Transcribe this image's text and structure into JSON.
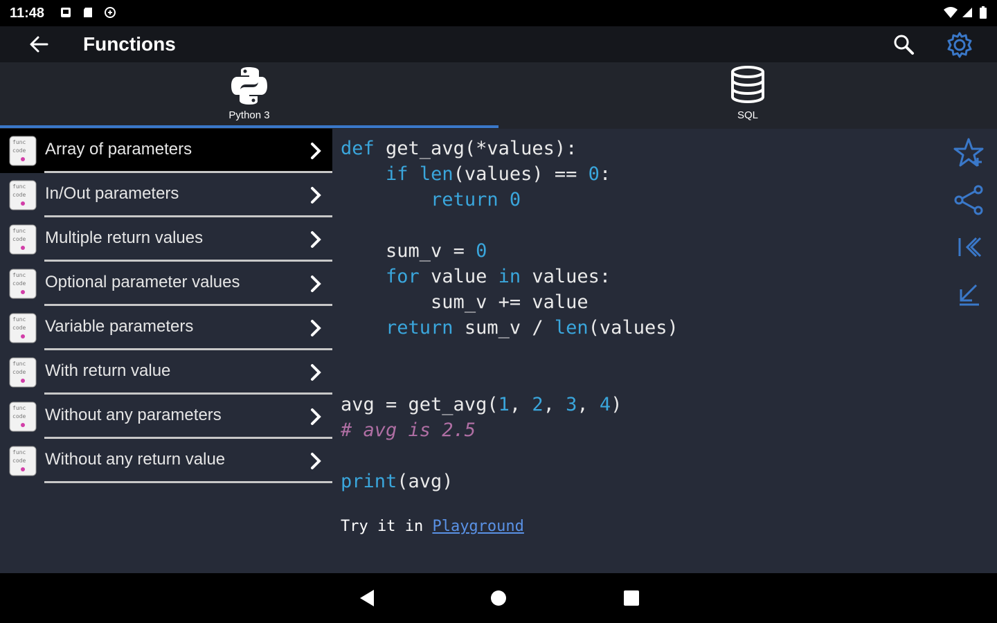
{
  "status": {
    "time": "11:48"
  },
  "appbar": {
    "title": "Functions"
  },
  "tabs": [
    {
      "label": "Python 3",
      "icon": "python-icon"
    },
    {
      "label": "SQL",
      "icon": "database-icon"
    }
  ],
  "list": [
    {
      "label": "Array of parameters"
    },
    {
      "label": "In/Out parameters"
    },
    {
      "label": "Multiple return values"
    },
    {
      "label": "Optional parameter values"
    },
    {
      "label": "Variable parameters"
    },
    {
      "label": "With return value"
    },
    {
      "label": "Without any parameters"
    },
    {
      "label": "Without any return value"
    }
  ],
  "code": {
    "l1": {
      "kw": "def",
      "rest": " get_avg(*values):"
    },
    "l2": {
      "indent": "    ",
      "kw": "if",
      "sp": " ",
      "fn": "len",
      "rest": "(values) == ",
      "num": "0",
      "end": ":"
    },
    "l3": {
      "indent": "        ",
      "kw": "return",
      "sp": " ",
      "num": "0"
    },
    "l5": {
      "indent": "    ",
      "rest": "sum_v = ",
      "num": "0"
    },
    "l6": {
      "indent": "    ",
      "kw": "for",
      "mid": " value ",
      "kw2": "in",
      "rest": " values:"
    },
    "l7": {
      "indent": "        ",
      "rest": "sum_v += value"
    },
    "l8": {
      "indent": "    ",
      "kw": "return",
      "rest": " sum_v / ",
      "fn": "len",
      "end": "(values)"
    },
    "l11": {
      "a": "avg = get_avg(",
      "n1": "1",
      "c1": ", ",
      "n2": "2",
      "c2": ", ",
      "n3": "3",
      "c3": ", ",
      "n4": "4",
      "end": ")"
    },
    "l12": {
      "comment": "# avg is 2.5"
    },
    "l14": {
      "fn": "print",
      "end": "(avg)"
    }
  },
  "try": {
    "text": "Try it in ",
    "link": "Playground"
  },
  "colors": {
    "accent": "#3a78c9",
    "keyword": "#3aa6dc",
    "comment": "#b06fa4",
    "background": "#262b38"
  }
}
